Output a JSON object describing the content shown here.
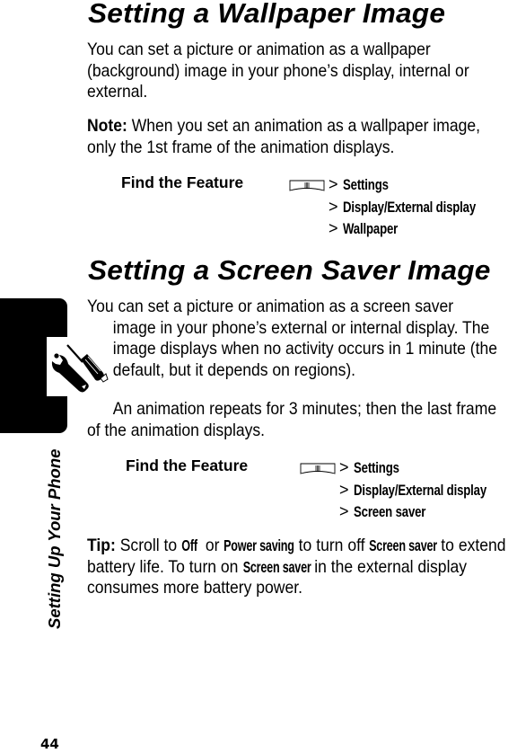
{
  "page": {
    "number": "44",
    "chapter_title": "Setting Up Your Phone"
  },
  "wallpaper_section": {
    "heading": "Setting a Wallpaper Image",
    "intro_lines": [
      "You can set a picture or animation as a wallpaper",
      "(background) image in your phone’s display, internal or",
      "external."
    ],
    "note_label": "Note:",
    "note_lines": [
      " When you set an animation as a wallpaper image,",
      "only the 1st frame of the animation displays."
    ],
    "find_feature": {
      "label": "Find the Feature",
      "softkey_icon": "menu-key-icon",
      "separator": ">",
      "path": [
        "Settings",
        "Display/External display",
        "Wallpaper"
      ]
    }
  },
  "screensaver_section": {
    "heading": "Setting a Screen Saver Image",
    "intro_lines": [
      "You can set a picture or animation as a screen saver",
      "image in your phone’s external or internal display. The",
      "image displays when no activity occurs in 1 minute (the",
      "default, but it depends on regions)."
    ],
    "repeat_lines": [
      "An animation repeats for 3 minutes; then the last frame",
      "of the animation displays."
    ],
    "find_feature": {
      "label": "Find the Feature",
      "softkey_icon": "menu-key-icon",
      "separator": ">",
      "path": [
        "Settings",
        "Display/External display",
        "Screen saver"
      ]
    },
    "tip": {
      "label": "Tip:",
      "t1": " Scroll to ",
      "m1": "Off",
      "t2": " or ",
      "m2": "Power saving",
      "t3": " to turn off ",
      "m3": "Screen saver",
      "t4": " to extend",
      "line2_a": "battery life. To turn on ",
      "line2_m": "Screen saver",
      "line2_b": " in the external display",
      "line3": "consumes more battery power."
    }
  },
  "side_tab": {
    "icon": "wrench-screwdriver-icon"
  }
}
